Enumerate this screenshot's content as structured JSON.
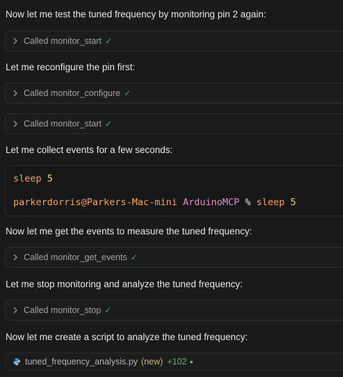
{
  "messages": [
    "Now let me test the tuned frequency by monitoring pin 2 again:",
    "Let me reconfigure the pin first:",
    "Let me collect events for a few seconds:",
    "Now let me get the events to measure the tuned frequency:",
    "Let me stop monitoring and analyze the tuned frequency:",
    "Now let me create a script to analyze the tuned frequency:"
  ],
  "tools": [
    {
      "label": "Called monitor_start",
      "check": "✓"
    },
    {
      "label": "Called monitor_configure",
      "check": "✓"
    },
    {
      "label": "Called monitor_start",
      "check": "✓"
    },
    {
      "label": "Called monitor_get_events",
      "check": "✓"
    },
    {
      "label": "Called monitor_stop",
      "check": "✓"
    }
  ],
  "terminal": {
    "command": "sleep",
    "command_arg": "5",
    "prompt_user": "parkerdorris@Parkers-Mac-mini",
    "prompt_dir": "ArduinoMCP",
    "prompt_symbol": "%",
    "prompt_command": "sleep",
    "prompt_arg": "5"
  },
  "file": {
    "name": "tuned_frequency_analysis.py",
    "status": "(new)",
    "added": "+102",
    "dot": "●",
    "icon": "python-icon"
  },
  "colors": {
    "background": "#1a1a1a",
    "check": "#4aa86b",
    "terminal_orange": "#f2a06a",
    "terminal_yellow": "#f0d27a",
    "terminal_pink": "#e48bd3"
  }
}
